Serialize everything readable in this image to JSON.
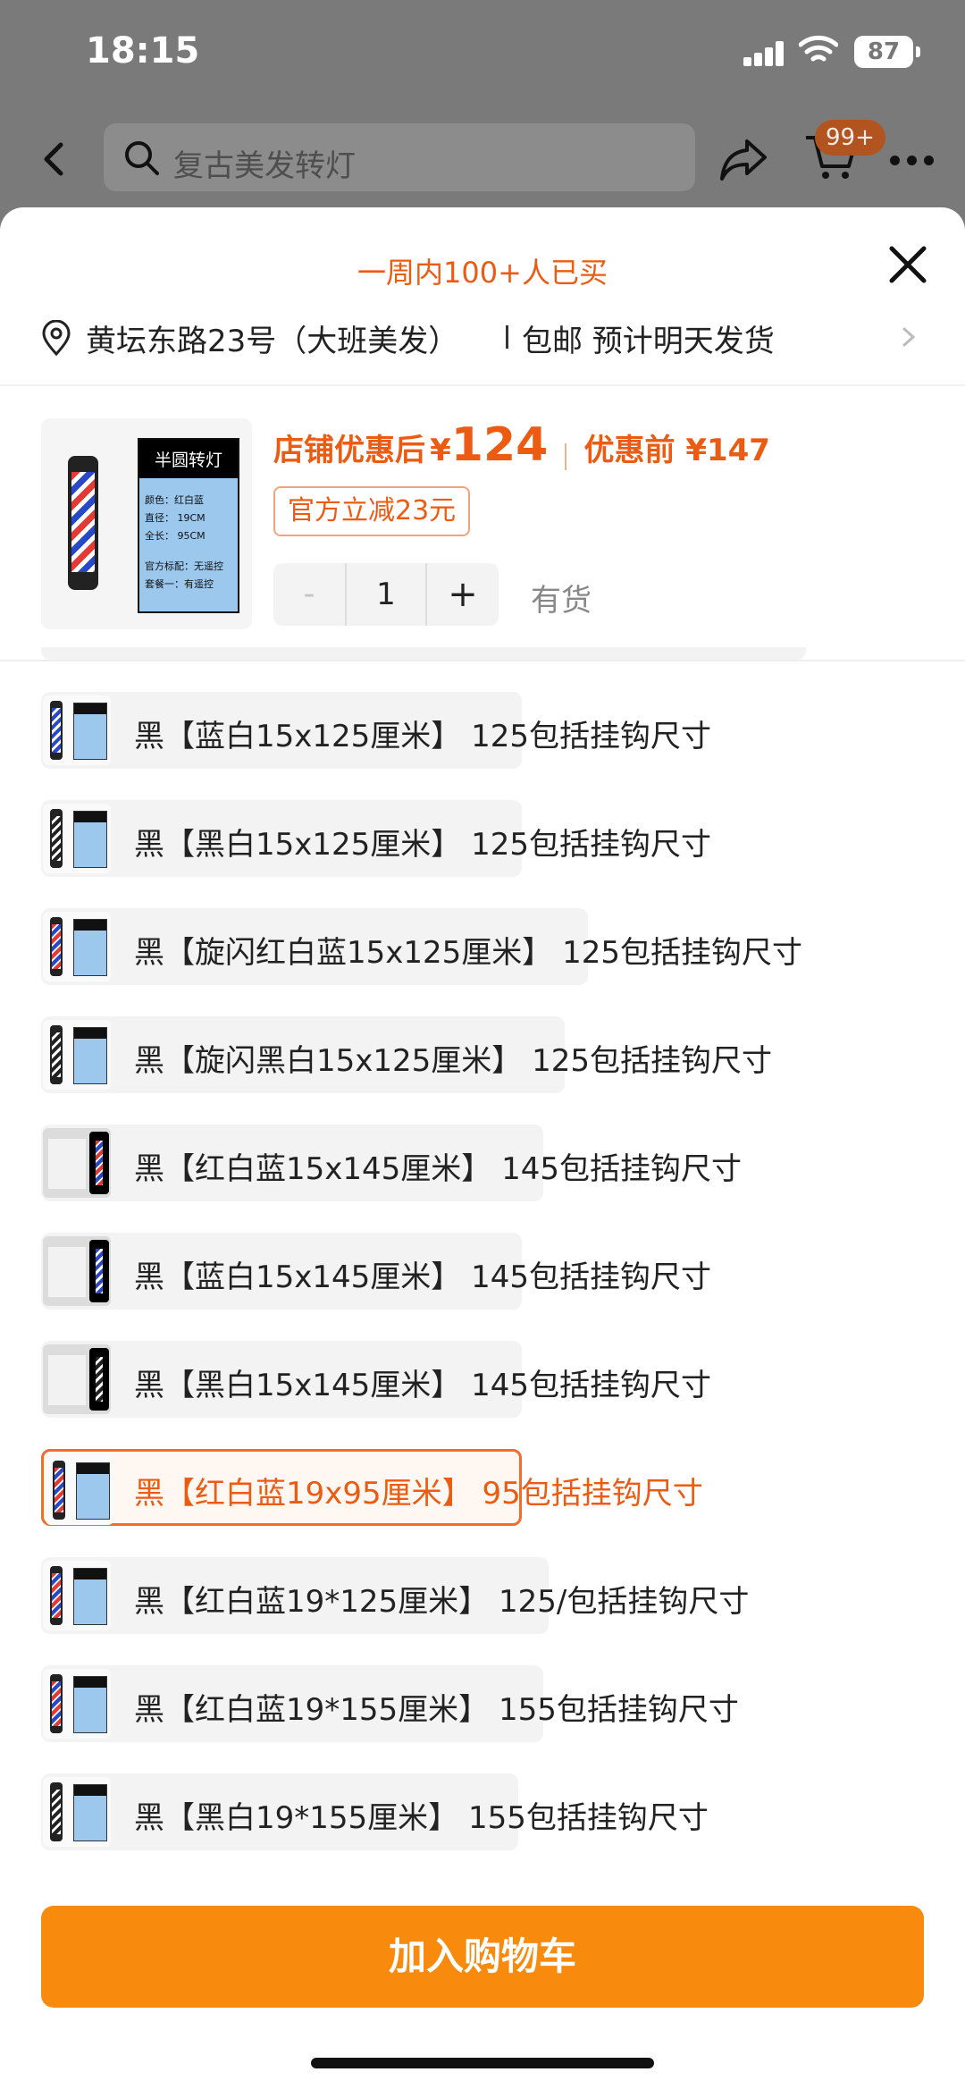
{
  "status": {
    "time": "18:15",
    "battery": "87"
  },
  "topbar": {
    "search_placeholder": "复古美发转灯",
    "cart_badge": "99+"
  },
  "sheet": {
    "bought_text": "一周内100+人已买",
    "address": "黄坛东路23号（大班美发）",
    "shipping": "包邮 预计明天发货",
    "product_card": {
      "title": "半圆转灯",
      "lines": [
        "颜色：红白蓝",
        "直径：  19CM",
        "全长：  95CM",
        "",
        "官方标配：无遥控",
        "套餐一：有遥控"
      ]
    },
    "price": {
      "after_label": "店铺优惠后",
      "after_currency": "¥",
      "after_value": "124",
      "before_label": "优惠前 ¥147"
    },
    "coupon": "官方立减23元",
    "quantity": {
      "minus": "-",
      "value": "1",
      "plus": "+"
    },
    "stock": "有货",
    "options": [
      {
        "label": "黑【蓝白15x125厘米】 125包括挂钩尺寸",
        "style": "bw",
        "thumb": "light",
        "selected": false
      },
      {
        "label": "黑【黑白15x125厘米】 125包括挂钩尺寸",
        "style": "kw",
        "thumb": "light",
        "selected": false
      },
      {
        "label": "黑【旋闪红白蓝15x125厘米】 125包括挂钩尺寸",
        "style": "rwb",
        "thumb": "light",
        "selected": false
      },
      {
        "label": "黑【旋闪黑白15x125厘米】 125包括挂钩尺寸",
        "style": "kw",
        "thumb": "light",
        "selected": false
      },
      {
        "label": "黑【红白蓝15x145厘米】 145包括挂钩尺寸",
        "style": "rwb",
        "thumb": "dark",
        "selected": false
      },
      {
        "label": "黑【蓝白15x145厘米】 145包括挂钩尺寸",
        "style": "bw",
        "thumb": "dark",
        "selected": false
      },
      {
        "label": "黑【黑白15x145厘米】 145包括挂钩尺寸",
        "style": "kw",
        "thumb": "dark",
        "selected": false
      },
      {
        "label": "黑【红白蓝19x95厘米】 95包括挂钩尺寸",
        "style": "rwb",
        "thumb": "light",
        "selected": true
      },
      {
        "label": "黑【红白蓝19*125厘米】 125/包括挂钩尺寸",
        "style": "rwb",
        "thumb": "light",
        "selected": false
      },
      {
        "label": "黑【红白蓝19*155厘米】 155包括挂钩尺寸",
        "style": "rwb",
        "thumb": "light",
        "selected": false
      },
      {
        "label": "黑【黑白19*155厘米】 155包括挂钩尺寸",
        "style": "kw",
        "thumb": "light",
        "selected": false
      }
    ],
    "add_to_cart": "加入购物车"
  },
  "colors": {
    "accent": "#ec5b12",
    "cta": "#f88a0e",
    "selected_border": "#f06e2a"
  }
}
